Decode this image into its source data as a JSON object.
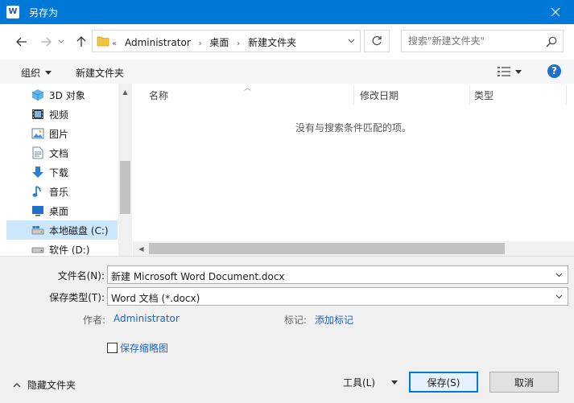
{
  "window": {
    "title": "另存为",
    "app_icon_letter": "W"
  },
  "address": {
    "overflow": "«",
    "crumbs": [
      "Administrator",
      "桌面",
      "新建文件夹"
    ]
  },
  "search": {
    "placeholder": "搜索\"新建文件夹\""
  },
  "toolbar": {
    "organize": "组织",
    "new_folder": "新建文件夹",
    "help": "?"
  },
  "sidebar": {
    "items": [
      {
        "label": "3D 对象",
        "icon": "3d-objects-icon"
      },
      {
        "label": "视频",
        "icon": "video-icon"
      },
      {
        "label": "图片",
        "icon": "pictures-icon"
      },
      {
        "label": "文档",
        "icon": "documents-icon"
      },
      {
        "label": "下载",
        "icon": "download-icon"
      },
      {
        "label": "音乐",
        "icon": "music-icon"
      },
      {
        "label": "桌面",
        "icon": "desktop-icon"
      },
      {
        "label": "本地磁盘 (C:)",
        "icon": "local-disk-icon",
        "selected": true
      },
      {
        "label": "软件 (D:)",
        "icon": "drive-icon"
      }
    ]
  },
  "file_list": {
    "columns": [
      "名称",
      "修改日期",
      "类型"
    ],
    "empty_message": "没有与搜索条件匹配的项。"
  },
  "form": {
    "filename_label": "文件名(N):",
    "filename_value": "新建 Microsoft Word Document.docx",
    "filetype_label": "保存类型(T):",
    "filetype_value": "Word 文档 (*.docx)",
    "author_label": "作者:",
    "author_value": "Administrator",
    "tags_label": "标记:",
    "tags_value": "添加标记",
    "thumbnail_label": "保存缩略图"
  },
  "footer": {
    "hide_folders": "隐藏文件夹",
    "tools": "工具(L)",
    "save": "保存(S)",
    "cancel": "取消"
  },
  "colors": {
    "titlebar": "#0078d7",
    "selected": "#cce8ff",
    "link": "#1a63c8"
  }
}
